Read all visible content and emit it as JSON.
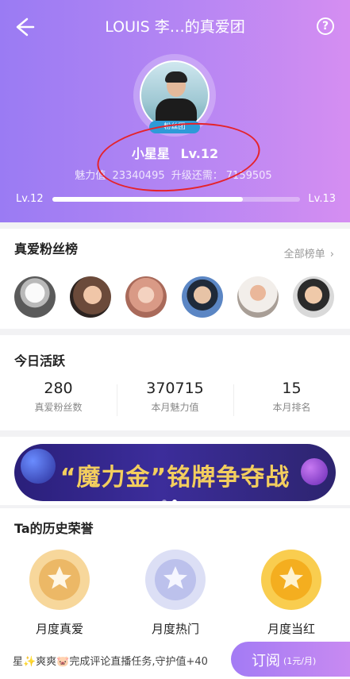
{
  "header": {
    "title": "LOUIS 李…的真爱团",
    "help_icon": "?",
    "badge_text": "粉丝团",
    "name": "小星星",
    "level_text": "Lv.12",
    "charm_label": "魅力值",
    "charm_value": "23340495",
    "upgrade_label": "升级还需：",
    "upgrade_value": "7159505",
    "level_left": "Lv.12",
    "level_right": "Lv.13",
    "progress": 0.77
  },
  "fans_rank": {
    "title": "真爱粉丝榜",
    "all_link": "全部榜单"
  },
  "today": {
    "title": "今日活跃",
    "stats": [
      {
        "value": "280",
        "label": "真爱粉丝数"
      },
      {
        "value": "370715",
        "label": "本月魅力值"
      },
      {
        "value": "15",
        "label": "本月排名"
      }
    ]
  },
  "banner": {
    "text": "“魔力金”铭牌争夺战"
  },
  "history": {
    "title": "Ta的历史荣誉",
    "items": [
      {
        "label": "月度真爱"
      },
      {
        "label": "月度热门"
      },
      {
        "label": "月度当红"
      }
    ]
  },
  "footer": {
    "message": "星✨爽爽🐷完成评论直播任务,守护值+40",
    "subscribe_label": "订阅",
    "subscribe_price": "(1元/月)"
  },
  "colors": {
    "header_gradient_start": "#9a7bf3",
    "header_gradient_end": "#d58ef2",
    "annotation": "#e5232b",
    "medal_gold": "#f2c06b",
    "medal_silver": "#c7cbf0",
    "medal_orange": "#f7b526"
  }
}
